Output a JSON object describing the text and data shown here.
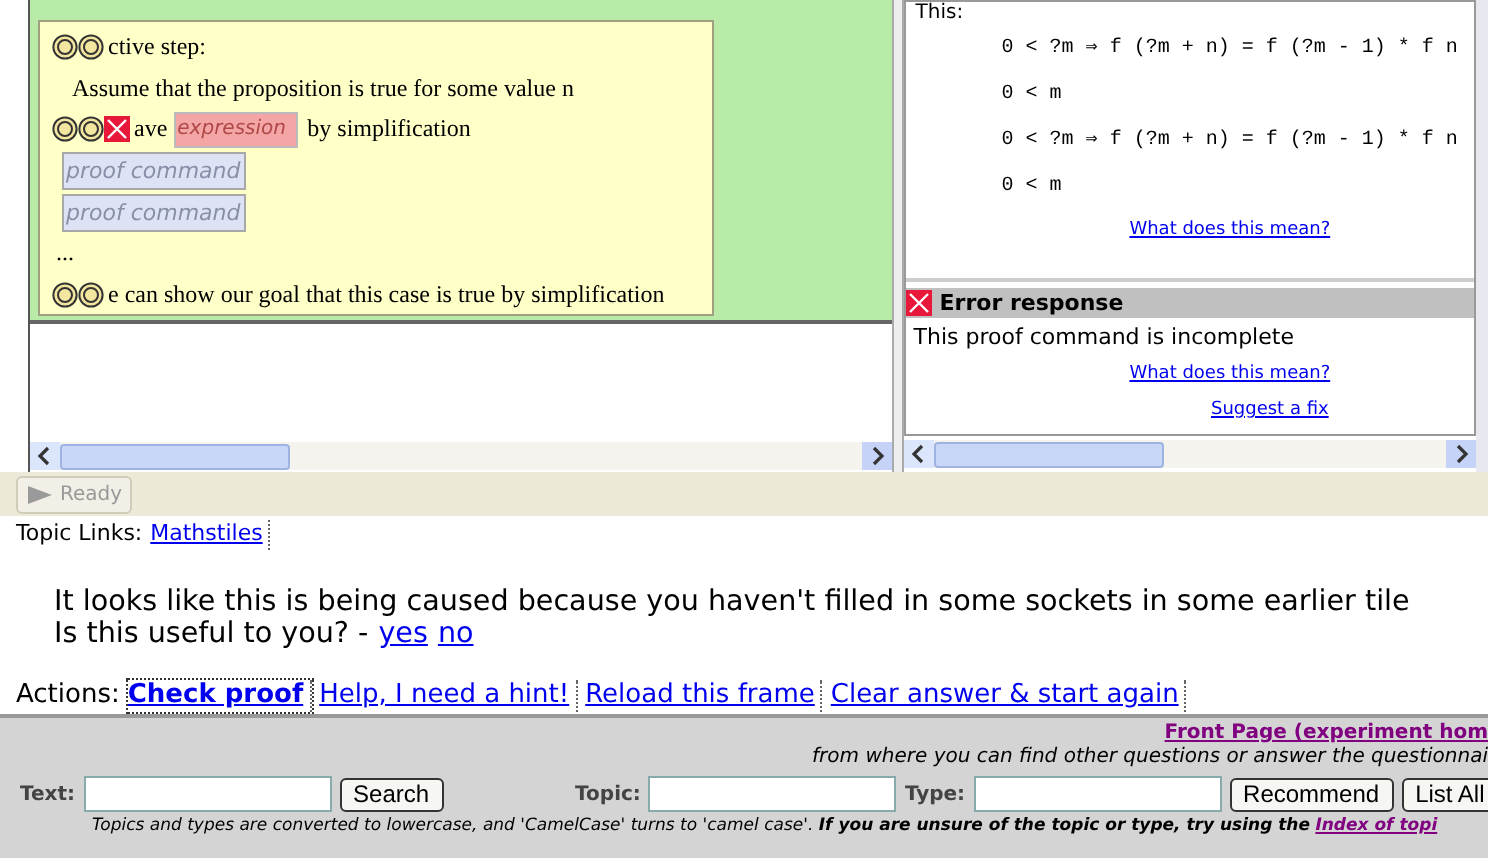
{
  "proof_pane": {
    "lines": [
      {
        "kind": "sentence",
        "markers": [
          {
            "kind": "coin"
          },
          {
            "kind": "coin"
          }
        ],
        "parts": [
          {
            "kind": "text",
            "text": "ctive step:"
          }
        ]
      },
      {
        "kind": "sentence",
        "indent": true,
        "parts": [
          {
            "kind": "text",
            "text": "Assume that the proposition is true for some value  n"
          }
        ]
      },
      {
        "kind": "sentence",
        "markers": [
          {
            "kind": "coin"
          },
          {
            "kind": "coin"
          },
          {
            "kind": "error"
          }
        ],
        "parts": [
          {
            "kind": "text",
            "text": "ave"
          },
          {
            "kind": "field",
            "placeholder": "expression",
            "invalid": true
          },
          {
            "kind": "text",
            "text": "by simplification"
          }
        ]
      },
      {
        "kind": "field",
        "placeholder": "proof command"
      },
      {
        "kind": "field",
        "placeholder": "proof command"
      },
      {
        "kind": "sentence",
        "parts": [
          {
            "kind": "text",
            "text": "..."
          }
        ]
      },
      {
        "kind": "sentence",
        "markers": [
          {
            "kind": "coin"
          },
          {
            "kind": "coin"
          }
        ],
        "parts": [
          {
            "kind": "text",
            "text": "e can show our goal that this case is true by simplification"
          }
        ]
      }
    ]
  },
  "goal_pane": {
    "heading": "This:",
    "formulas": [
      "0 < ?m ⇒ f (?m + n) = f (?m - 1) * f n",
      "0 < m",
      "0 < ?m ⇒ f (?m + n) = f (?m - 1) * f n",
      "0 < m"
    ],
    "link": "What does this mean?"
  },
  "error": {
    "title": "Error response",
    "message": "This proof command is incomplete",
    "links": [
      "What does this mean?",
      "Suggest a fix"
    ]
  },
  "status_bar": {
    "button": "Ready"
  },
  "topic_links": {
    "label": "Topic Links:",
    "links": [
      "Mathstiles"
    ]
  },
  "hint": {
    "message": "It looks like this is being caused because you haven't filled in some sockets in some earlier tile",
    "question": "Is this useful to you? -",
    "answers": [
      "yes",
      "no"
    ]
  },
  "actions": {
    "label": "Actions:",
    "items": [
      {
        "label": "Check proof",
        "selected": true
      },
      {
        "label": "Help, I need a hint!",
        "selected": false
      },
      {
        "label": "Reload this frame",
        "selected": false
      },
      {
        "label": "Clear answer & start again",
        "selected": false
      }
    ]
  },
  "footer": {
    "front_link": "Front Page (experiment hom",
    "front_note": "from where you can find other questions or answer the questionnai",
    "form": [
      {
        "kind": "label",
        "text": "Text:"
      },
      {
        "kind": "input"
      },
      {
        "kind": "button",
        "text": "Search"
      },
      {
        "kind": "label",
        "text": "Topic:"
      },
      {
        "kind": "input"
      },
      {
        "kind": "label",
        "text": "Type:"
      },
      {
        "kind": "input"
      },
      {
        "kind": "button",
        "text": "Recommend"
      },
      {
        "kind": "button",
        "text": "List All"
      }
    ],
    "note": "Topics and types are converted to lowercase, and 'CamelCase' turns to 'camel case'. **If you are unsure of the topic or type, try using the**",
    "note_link": "Index of topi"
  }
}
